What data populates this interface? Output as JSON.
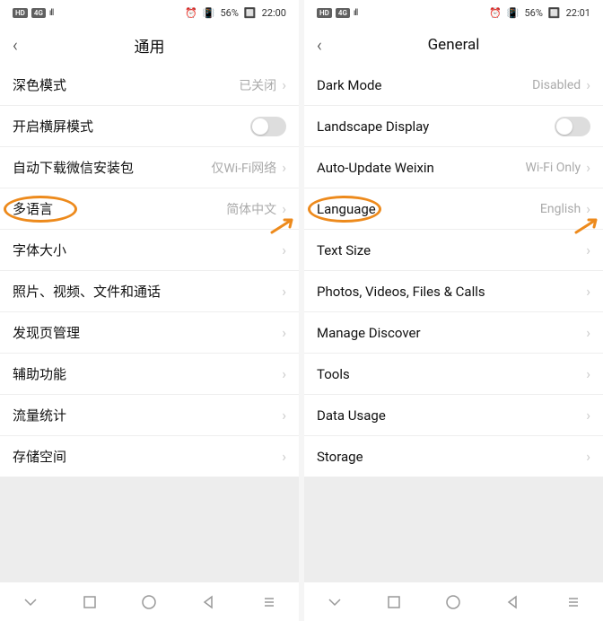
{
  "left": {
    "status": {
      "network_badge": "HD",
      "signal_badge": "4G",
      "battery_text": "56%",
      "time": "22:00"
    },
    "header": {
      "title": "通用"
    },
    "rows": [
      {
        "label": "深色模式",
        "value": "已关闭",
        "chevron": true
      },
      {
        "label": "开启横屏模式",
        "toggle": true
      },
      {
        "label": "自动下载微信安装包",
        "value": "仅Wi-Fi网络",
        "chevron": true
      },
      {
        "label": "多语言",
        "value": "简体中文",
        "chevron": true,
        "highlight": true
      },
      {
        "label": "字体大小",
        "chevron": true
      },
      {
        "label": "照片、视频、文件和通话",
        "chevron": true
      },
      {
        "label": "发现页管理",
        "chevron": true
      },
      {
        "label": "辅助功能",
        "chevron": true
      },
      {
        "label": "流量统计",
        "chevron": true
      },
      {
        "label": "存储空间",
        "chevron": true
      }
    ]
  },
  "right": {
    "status": {
      "network_badge": "HD",
      "signal_badge": "4G",
      "battery_text": "56%",
      "time": "22:01"
    },
    "header": {
      "title": "General"
    },
    "rows": [
      {
        "label": "Dark Mode",
        "value": "Disabled",
        "chevron": true
      },
      {
        "label": "Landscape Display",
        "toggle": true
      },
      {
        "label": "Auto-Update Weixin",
        "value": "Wi-Fi Only",
        "chevron": true
      },
      {
        "label": "Language",
        "value": "English",
        "chevron": true,
        "highlight": true
      },
      {
        "label": "Text Size",
        "chevron": true
      },
      {
        "label": "Photos, Videos, Files & Calls",
        "chevron": true
      },
      {
        "label": "Manage Discover",
        "chevron": true
      },
      {
        "label": "Tools",
        "chevron": true
      },
      {
        "label": "Data Usage",
        "chevron": true
      },
      {
        "label": "Storage",
        "chevron": true
      }
    ]
  },
  "annotation": {
    "oval_color": "#ed8a1c",
    "arrow_color": "#ed8a1c"
  }
}
